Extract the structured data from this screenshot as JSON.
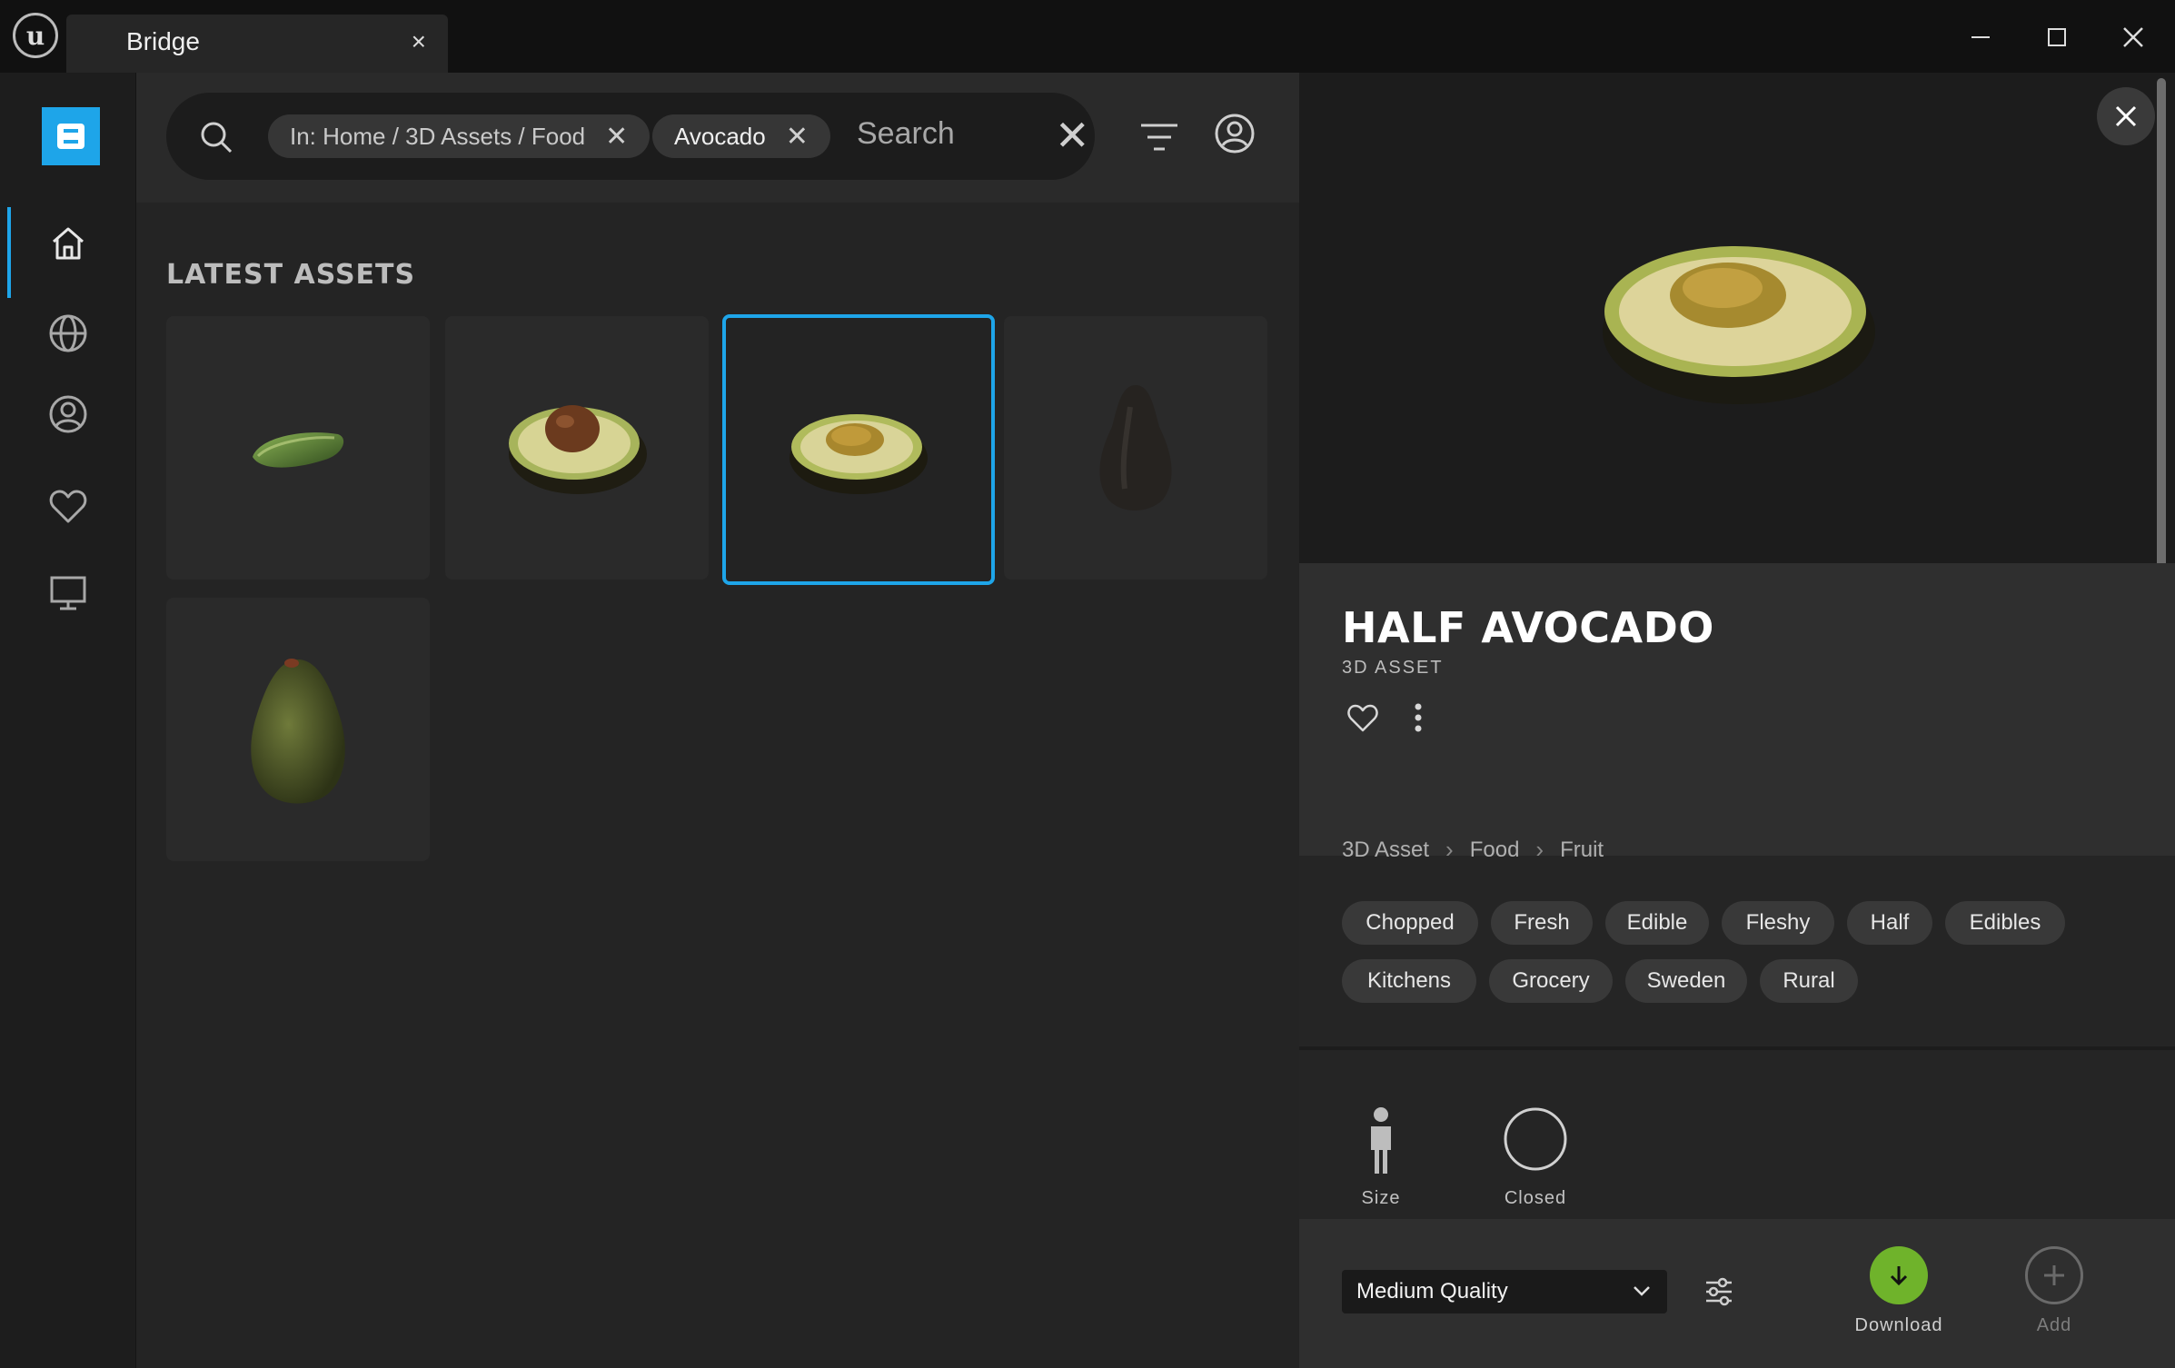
{
  "window": {
    "tab_title": "Bridge",
    "tab_close": "×"
  },
  "colors": {
    "accent": "#1ea5e9",
    "download": "#6fb32b",
    "background": "#1b1b1b"
  },
  "sidebar": {
    "brand_letter": "B",
    "items": [
      {
        "name": "home",
        "icon": "home-icon",
        "active": true
      },
      {
        "name": "globe",
        "icon": "globe-icon",
        "active": false
      },
      {
        "name": "account",
        "icon": "user-circle-icon",
        "active": false
      },
      {
        "name": "favorites",
        "icon": "heart-icon",
        "active": false
      },
      {
        "name": "local",
        "icon": "monitor-icon",
        "active": false
      }
    ]
  },
  "search": {
    "filters": [
      {
        "label": "In: Home / 3D Assets / Food"
      },
      {
        "label": "Avocado"
      }
    ],
    "placeholder": "Search",
    "clear": "✕",
    "chip_remove": "✕"
  },
  "main": {
    "section_title": "LATEST ASSETS"
  },
  "detail": {
    "title": "HALF AVOCADO",
    "type": "3D ASSET",
    "breadcrumb": [
      "3D Asset",
      "Food",
      "Fruit"
    ],
    "tags": [
      "Chopped",
      "Fresh",
      "Edible",
      "Fleshy",
      "Half",
      "Edibles",
      "Kitchens",
      "Grocery",
      "Sweden",
      "Rural"
    ],
    "properties": [
      {
        "label": "Size",
        "icon": "person-icon"
      },
      {
        "label": "Closed",
        "icon": "circle-icon"
      }
    ],
    "quality": "Medium Quality",
    "download_label": "Download",
    "add_label": "Add"
  }
}
